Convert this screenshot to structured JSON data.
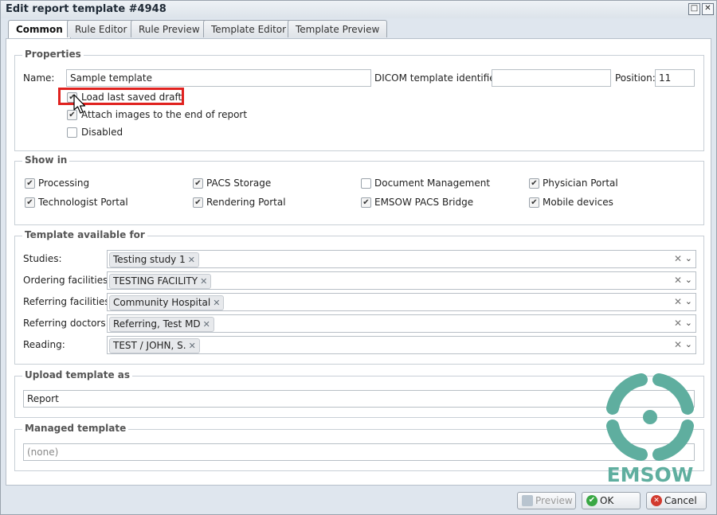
{
  "window": {
    "title": "Edit report template #4948",
    "min_label": "□",
    "close_label": "✕"
  },
  "tabs": [
    {
      "label": "Common",
      "active": true
    },
    {
      "label": "Rule Editor",
      "active": false
    },
    {
      "label": "Rule Preview",
      "active": false
    },
    {
      "label": "Template Editor",
      "active": false
    },
    {
      "label": "Template Preview",
      "active": false
    }
  ],
  "properties": {
    "legend": "Properties",
    "name_label": "Name:",
    "name_value": "Sample template",
    "dicom_label": "DICOM template identifier:",
    "dicom_value": "",
    "position_label": "Position:",
    "position_value": "11",
    "checkboxes": [
      {
        "label": "Load last saved draft",
        "checked": true
      },
      {
        "label": "Attach images to the end of report",
        "checked": true
      },
      {
        "label": "Disabled",
        "checked": false
      }
    ]
  },
  "show_in": {
    "legend": "Show in",
    "items": [
      {
        "label": "Processing",
        "checked": true
      },
      {
        "label": "PACS Storage",
        "checked": true
      },
      {
        "label": "Document Management",
        "checked": false
      },
      {
        "label": "Physician Portal",
        "checked": true
      },
      {
        "label": "Technologist Portal",
        "checked": true
      },
      {
        "label": "Rendering Portal",
        "checked": true
      },
      {
        "label": "EMSOW PACS Bridge",
        "checked": true
      },
      {
        "label": "Mobile devices",
        "checked": true
      }
    ]
  },
  "available_for": {
    "legend": "Template available for",
    "rows": [
      {
        "label": "Studies:",
        "tag": "Testing study 1"
      },
      {
        "label": "Ordering facilities:",
        "tag": "TESTING FACILITY"
      },
      {
        "label": "Referring facilities:",
        "tag": "Community Hospital"
      },
      {
        "label": "Referring doctors:",
        "tag": "Referring, Test MD"
      },
      {
        "label": "Reading:",
        "tag": "TEST / JOHN, S."
      }
    ],
    "clear_glyph": "✕",
    "arrow_glyph": "⌄"
  },
  "upload": {
    "legend": "Upload template as",
    "value": "Report"
  },
  "managed": {
    "legend": "Managed template",
    "placeholder": "(none)"
  },
  "buttons": {
    "preview": "Preview",
    "ok": "OK",
    "cancel": "Cancel"
  },
  "logo": {
    "text": "EMSOW",
    "color": "#5fae9f"
  },
  "colors": {
    "highlight": "#e0221f",
    "ok_icon": "#3aa845",
    "cancel_icon": "#d23a2e"
  }
}
